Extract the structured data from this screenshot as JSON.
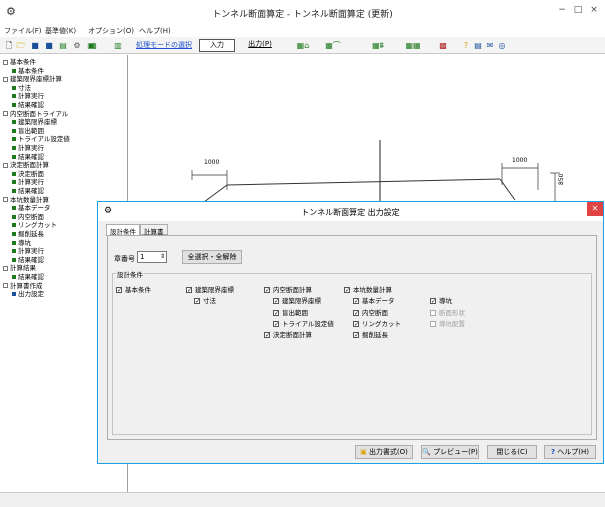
{
  "window": {
    "title": "トンネル断面算定 - トンネル断面算定 (更新)",
    "minimize": "−",
    "maximize": "□",
    "close": "×"
  },
  "menu": [
    "ファイル(F)",
    "基準値(K)",
    "オプション(O)",
    "ヘルプ(H)"
  ],
  "toolbar": {
    "mode_label": "処理モードの選択",
    "input_tab": "入力",
    "output_tab": "出力(P)"
  },
  "tree": [
    {
      "label": "基本条件",
      "level": 0,
      "kind": "group"
    },
    {
      "label": "基本条件",
      "level": 1,
      "kind": "leaf"
    },
    {
      "label": "建築限界座標計算",
      "level": 0,
      "kind": "group"
    },
    {
      "label": "寸法",
      "level": 1,
      "kind": "leaf"
    },
    {
      "label": "計算実行",
      "level": 1,
      "kind": "leaf"
    },
    {
      "label": "結果確認",
      "level": 1,
      "kind": "leaf"
    },
    {
      "label": "内空断面トライアル",
      "level": 0,
      "kind": "group"
    },
    {
      "label": "建築限界座標",
      "level": 1,
      "kind": "leaf"
    },
    {
      "label": "盲出範囲",
      "level": 1,
      "kind": "leaf"
    },
    {
      "label": "トライアル設定値",
      "level": 1,
      "kind": "leaf"
    },
    {
      "label": "計算実行",
      "level": 1,
      "kind": "leaf"
    },
    {
      "label": "結果確認",
      "level": 1,
      "kind": "leaf"
    },
    {
      "label": "決定断面計算",
      "level": 0,
      "kind": "group"
    },
    {
      "label": "決定断面",
      "level": 1,
      "kind": "leaf"
    },
    {
      "label": "計算実行",
      "level": 1,
      "kind": "leaf"
    },
    {
      "label": "結果確認",
      "level": 1,
      "kind": "leaf"
    },
    {
      "label": "本坑数量計算",
      "level": 0,
      "kind": "group"
    },
    {
      "label": "基本データ",
      "level": 1,
      "kind": "leaf"
    },
    {
      "label": "内空断面",
      "level": 1,
      "kind": "leaf"
    },
    {
      "label": "リングカット",
      "level": 1,
      "kind": "leaf"
    },
    {
      "label": "掘削延長",
      "level": 1,
      "kind": "leaf"
    },
    {
      "label": "導坑",
      "level": 1,
      "kind": "leaf"
    },
    {
      "label": "計算実行",
      "level": 1,
      "kind": "leaf"
    },
    {
      "label": "結果確認",
      "level": 1,
      "kind": "leaf"
    },
    {
      "label": "計算結果",
      "level": 0,
      "kind": "group"
    },
    {
      "label": "結果確認",
      "level": 1,
      "kind": "leaf"
    },
    {
      "label": "計算書作成",
      "level": 0,
      "kind": "group"
    },
    {
      "label": "出力設定",
      "level": 1,
      "kind": "leaf"
    }
  ],
  "drawing": {
    "dim_left": "1000",
    "dim_right": "1000",
    "dim_vert": "850"
  },
  "dialog": {
    "title": "トンネル断面算定 出力設定",
    "tabs": [
      "設計条件",
      "計算書"
    ],
    "chapter_label": "章番号",
    "chapter_value": "1",
    "select_all_button": "全選択・全解除",
    "group_label": "設計条件",
    "checks": [
      {
        "label": "基本条件",
        "checked": true,
        "enabled": true
      },
      {
        "label": "建築限界座標",
        "checked": true,
        "enabled": true
      },
      {
        "label": "寸法",
        "checked": true,
        "enabled": true
      },
      {
        "label": "内空断面計算",
        "checked": true,
        "enabled": true
      },
      {
        "label": "建築限界座標",
        "checked": true,
        "enabled": true
      },
      {
        "label": "盲出範囲",
        "checked": true,
        "enabled": true
      },
      {
        "label": "トライアル設定値",
        "checked": true,
        "enabled": true
      },
      {
        "label": "決定断面計算",
        "checked": true,
        "enabled": true
      },
      {
        "label": "本坑数量計算",
        "checked": true,
        "enabled": true
      },
      {
        "label": "基本データ",
        "checked": true,
        "enabled": true
      },
      {
        "label": "内空断面",
        "checked": true,
        "enabled": true
      },
      {
        "label": "リングカット",
        "checked": true,
        "enabled": true
      },
      {
        "label": "掘削延長",
        "checked": true,
        "enabled": true
      },
      {
        "label": "導坑",
        "checked": true,
        "enabled": true
      },
      {
        "label": "断面形状",
        "checked": false,
        "enabled": false
      },
      {
        "label": "導坑配置",
        "checked": false,
        "enabled": false
      }
    ],
    "buttons": {
      "output": "出力書式(O)",
      "preview": "プレビュー(P)",
      "close": "閉じる(C)",
      "help": "ヘルプ(H)"
    }
  }
}
